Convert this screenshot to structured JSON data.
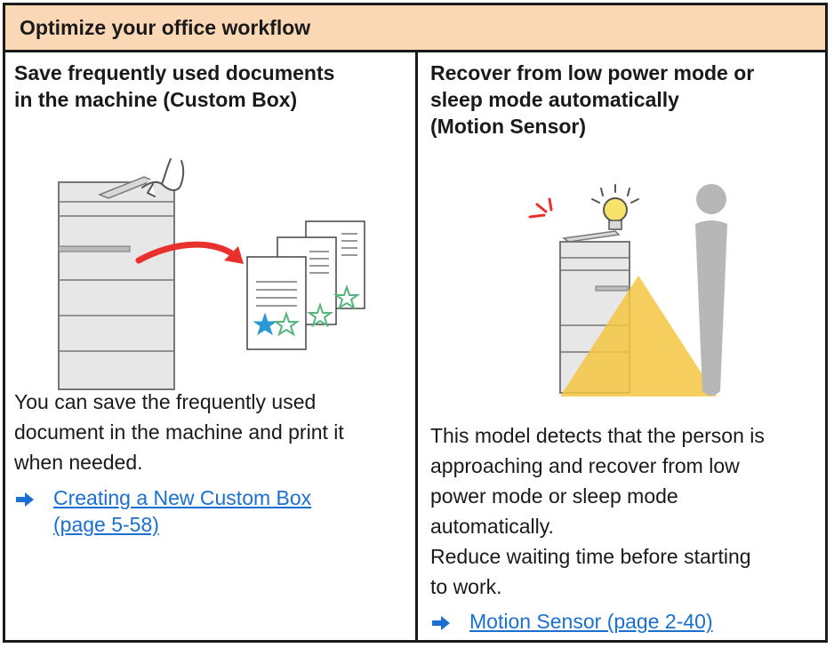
{
  "header": {
    "title": "Optimize your office workflow"
  },
  "left": {
    "title_line1": "Save frequently used documents",
    "title_line2": "in the machine (Custom Box)",
    "body_line1": "You can save the frequently used",
    "body_line2": "document in the machine and print it",
    "body_line3": "when needed.",
    "link_line1": "Creating a New Custom Box ",
    "link_line2": "(page 5-58)"
  },
  "right": {
    "title_line1": "Recover from low power mode or",
    "title_line2": "sleep mode automatically",
    "title_line3": "(Motion Sensor)",
    "body1_line1": "This model detects that the person is",
    "body1_line2": "approaching and recover from low",
    "body1_line3": "power mode or sleep mode",
    "body1_line4": "automatically.",
    "body2_line1": "Reduce waiting time before starting",
    "body2_line2": "to work.",
    "link": "Motion Sensor (page 2-40)"
  },
  "colors": {
    "header_bg": "#fbd8b5",
    "link": "#1a6fd0",
    "arrow": "#1a6fd0",
    "red_arrow": "#e8312c",
    "star_blue": "#2a9ad6",
    "star_green": "#56b57a",
    "light_cone": "#f5c542"
  },
  "icons": [
    "printer-icon",
    "hand-icon",
    "curved-arrow-icon",
    "documents-icon",
    "star-icon",
    "lightbulb-icon",
    "person-icon",
    "link-arrow-icon"
  ]
}
